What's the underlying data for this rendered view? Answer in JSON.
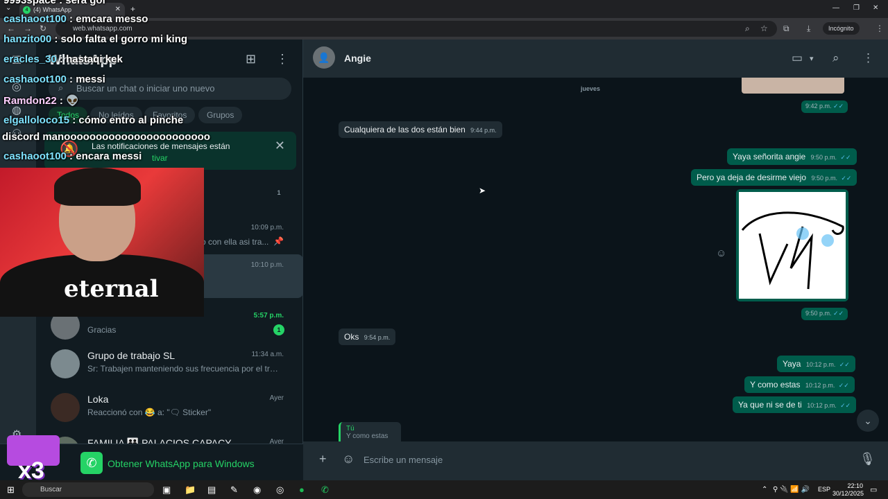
{
  "browser": {
    "tab_title": "(4) WhatsApp",
    "tab_badge": "4",
    "url": "web.whatsapp.com",
    "incognito_label": "Incógnito"
  },
  "sidebar": {
    "title": "WhatsApp",
    "search_placeholder": "Buscar un chat o iniciar uno nuevo",
    "filters": [
      "Todos",
      "No leídos",
      "Favoritos",
      "Grupos"
    ],
    "notification": {
      "text": "Las notificaciones de mensajes están",
      "link": "tivar"
    },
    "chats": [
      {
        "name": "",
        "time": "",
        "preview": "",
        "badge": "1"
      },
      {
        "name": "",
        "time": "10:09 p.m.",
        "preview": "o con ella asi tra..."
      },
      {
        "name": "",
        "time": "10:10 p.m.",
        "preview": ""
      },
      {
        "name": "",
        "time": "5:57 p.m.",
        "preview": "Gracias",
        "badge": "1"
      },
      {
        "name": "Grupo de trabajo SL",
        "time": "11:34 a.m.",
        "preview": "Sr: Trabajen manteniendo sus frecuencia por el trafi..."
      },
      {
        "name": "Loka",
        "time": "Ayer",
        "preview": "Reaccionó con 😂 a: \"🗨 Sticker\""
      },
      {
        "name": "FAMILIA 👪 PALACIOS CAPACY",
        "time": "Ayer",
        "preview": ""
      }
    ],
    "get_windows": "Obtener WhatsApp para Windows"
  },
  "chat": {
    "contact_name": "Angie",
    "day_separator": "jueves",
    "messages": [
      {
        "dir": "out",
        "text": "",
        "time": "9:42 p.m."
      },
      {
        "dir": "in",
        "text": "Cualquiera de las dos están bien",
        "time": "9:44 p.m."
      },
      {
        "dir": "out",
        "text": "Yaya señorita angie",
        "time": "9:50 p.m."
      },
      {
        "dir": "out",
        "text": "Pero ya deja de desirme viejo",
        "time": "9:50 p.m."
      },
      {
        "dir": "out",
        "text": "",
        "time": "9:50 p.m."
      },
      {
        "dir": "in",
        "text": "Oks",
        "time": "9:54 p.m."
      },
      {
        "dir": "out",
        "text": "Yaya",
        "time": "10:12 p.m."
      },
      {
        "dir": "out",
        "text": "Y como estas",
        "time": "10:12 p.m."
      },
      {
        "dir": "out",
        "text": "Ya que ni se de ti",
        "time": "10:12 p.m."
      }
    ],
    "reply_author": "Tú",
    "reply_snippet": "Y como estas",
    "composer_placeholder": "Escribe un mensaje"
  },
  "stream_overlay": {
    "chat_lines": [
      {
        "user": "",
        "text": "9993space : será gol"
      },
      {
        "user": "cashaoot100",
        "text": " : emcara messo"
      },
      {
        "user": "hanzito00",
        "text": " : solo falta el gorro mi king"
      },
      {
        "user": "eracles_30",
        "text": " : hastaqi kek"
      },
      {
        "user": "cashaoot100",
        "text": " : messi"
      },
      {
        "user": "Ramdon22",
        "text": " : 👽"
      },
      {
        "user": "elgalloloco15",
        "text": " : cómo entro al pinche"
      },
      {
        "user": "",
        "text": "discord manooooooooooooooooooooooo"
      },
      {
        "user": "cashaoot100",
        "text": " : encara messi"
      }
    ],
    "shirt_text": "eternal",
    "bits_text": "x3"
  },
  "taskbar": {
    "search_label": "Buscar",
    "language": "ESP",
    "time": "22:10",
    "date": "30/12/2025"
  },
  "colors": {
    "accent": "#25d366",
    "panel": "#111b21",
    "header": "#202c33",
    "outgoing": "#005c4b",
    "ticks": "#53bdeb"
  }
}
